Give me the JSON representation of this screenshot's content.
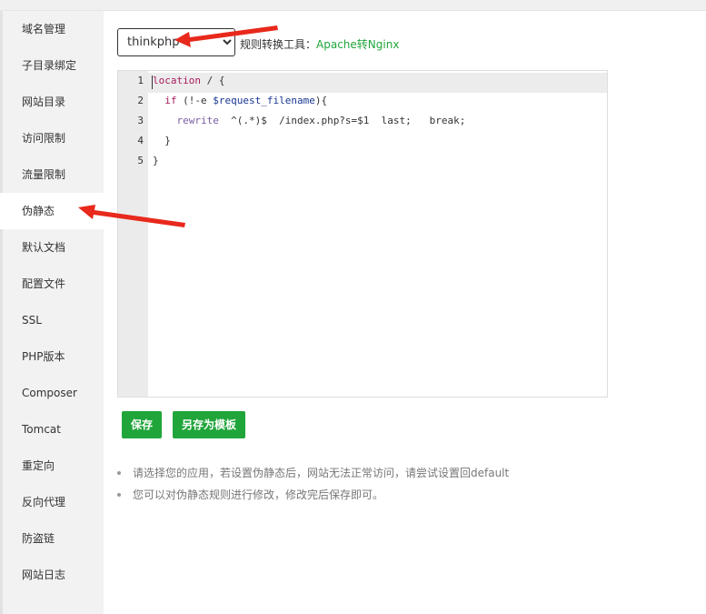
{
  "sidebar": {
    "items": [
      {
        "label": "域名管理"
      },
      {
        "label": "子目录绑定"
      },
      {
        "label": "网站目录"
      },
      {
        "label": "访问限制"
      },
      {
        "label": "流量限制"
      },
      {
        "label": "伪静态"
      },
      {
        "label": "默认文档"
      },
      {
        "label": "配置文件"
      },
      {
        "label": "SSL"
      },
      {
        "label": "PHP版本"
      },
      {
        "label": "Composer"
      },
      {
        "label": "Tomcat"
      },
      {
        "label": "重定向"
      },
      {
        "label": "反向代理"
      },
      {
        "label": "防盗链"
      },
      {
        "label": "网站日志"
      }
    ],
    "active_index": 5
  },
  "toolbar": {
    "template_selected": "thinkphp",
    "tool_label": "规则转换工具：",
    "tool_link": "Apache转Nginx"
  },
  "editor": {
    "line_numbers": [
      "1",
      "2",
      "3",
      "4",
      "5"
    ],
    "lines": {
      "l1": {
        "keyword": "location",
        "rest": " / {"
      },
      "l2": {
        "indent": "  ",
        "keyword": "if",
        "mid": " (!-e ",
        "var": "$request_filename",
        "rest": "){"
      },
      "l3": {
        "indent": "    ",
        "keyword": "rewrite",
        "rest": "  ^(.*)$  /index.php?s=$1  last;   break;"
      },
      "l4": {
        "text": "  }"
      },
      "l5": {
        "text": "}"
      }
    }
  },
  "buttons": {
    "save_label": "保存",
    "save_as_template_label": "另存为模板"
  },
  "tips": [
    "请选择您的应用，若设置伪静态后，网站无法正常访问，请尝试设置回default",
    "您可以对伪静态规则进行修改，修改完后保存即可。"
  ],
  "colors": {
    "accent": "#20a53a",
    "annotation_arrow": "#e8291c",
    "sidebar_bg": "#f2f2f2"
  }
}
